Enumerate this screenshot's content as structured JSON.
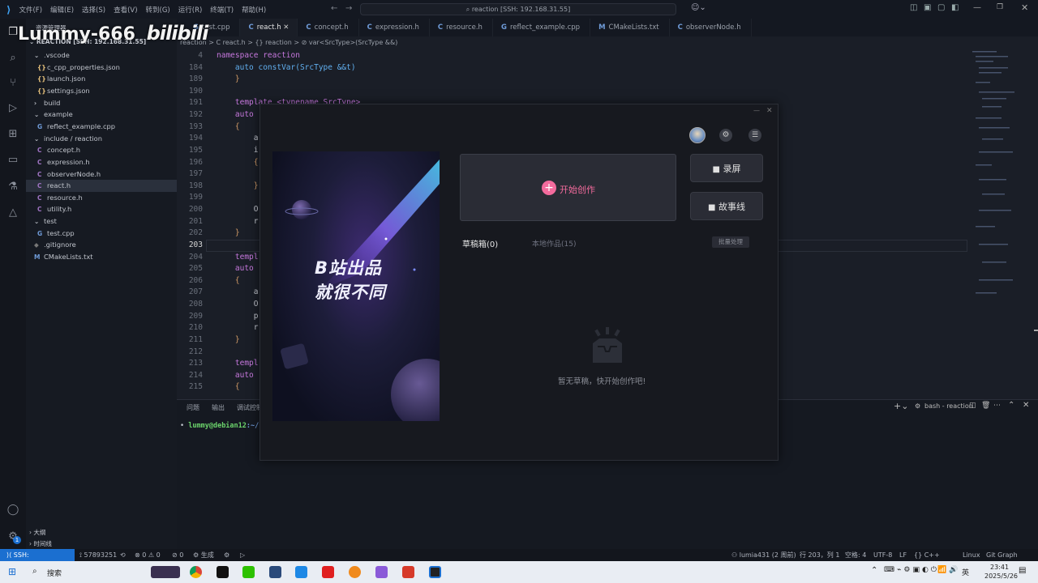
{
  "titlebar": {
    "menu": [
      "文件(F)",
      "编辑(E)",
      "选择(S)",
      "查看(V)",
      "转到(G)",
      "运行(R)",
      "终端(T)",
      "帮助(H)"
    ],
    "search": "reaction [SSH: 192.168.31.55]"
  },
  "watermark": {
    "text": "Lummy-666",
    "logo": "bilibili"
  },
  "sidebar": {
    "header": "资源管理器",
    "root": "REACTION [SSH: 192.168.31.55]",
    "rows": [
      {
        "label": ".vscode",
        "kind": "folder-open",
        "depth": 1
      },
      {
        "label": "c_cpp_properties.json",
        "kind": "json",
        "depth": 2
      },
      {
        "label": "launch.json",
        "kind": "json",
        "depth": 2
      },
      {
        "label": "settings.json",
        "kind": "json",
        "depth": 2
      },
      {
        "label": "build",
        "kind": "folder",
        "depth": 1
      },
      {
        "label": "example",
        "kind": "folder-open",
        "depth": 1
      },
      {
        "label": "reflect_example.cpp",
        "kind": "cpp",
        "depth": 2
      },
      {
        "label": "include / reaction",
        "kind": "folder-open",
        "depth": 1
      },
      {
        "label": "concept.h",
        "kind": "h",
        "depth": 2
      },
      {
        "label": "expression.h",
        "kind": "h",
        "depth": 2
      },
      {
        "label": "observerNode.h",
        "kind": "h",
        "depth": 2
      },
      {
        "label": "react.h",
        "kind": "h",
        "depth": 2,
        "active": true
      },
      {
        "label": "resource.h",
        "kind": "h",
        "depth": 2
      },
      {
        "label": "utility.h",
        "kind": "h",
        "depth": 2
      },
      {
        "label": "test",
        "kind": "folder-open",
        "depth": 1
      },
      {
        "label": "test.cpp",
        "kind": "cpp",
        "depth": 2
      },
      {
        "label": ".gitignore",
        "kind": "git",
        "depth": 1
      },
      {
        "label": "CMakeLists.txt",
        "kind": "cmake",
        "depth": 1
      }
    ],
    "outline": "大纲",
    "timeline": "时间线"
  },
  "tabs": [
    {
      "label": "test.cpp",
      "active": false
    },
    {
      "label": "react.h",
      "active": true
    },
    {
      "label": "concept.h",
      "active": false
    },
    {
      "label": "expression.h",
      "active": false
    },
    {
      "label": "resource.h",
      "active": false
    },
    {
      "label": "reflect_example.cpp",
      "active": false
    },
    {
      "label": "CMakeLists.txt",
      "active": false
    },
    {
      "label": "observerNode.h",
      "active": false
    }
  ],
  "breadcrumb": "reaction  >  C react.h  >  {} reaction  >  ⊘ var<SrcType>(SrcType &&)",
  "editor": {
    "lines": [
      {
        "n": "4",
        "code": "namespace reaction"
      },
      {
        "n": "184",
        "code": "    auto constVar(SrcType &&t)"
      },
      {
        "n": "189",
        "code": "    }"
      },
      {
        "n": "190",
        "code": ""
      },
      {
        "n": "191",
        "code": "    template <typename SrcType>"
      },
      {
        "n": "192",
        "code": "    auto"
      },
      {
        "n": "193",
        "code": "    {"
      },
      {
        "n": "194",
        "code": "        a"
      },
      {
        "n": "195",
        "code": "        i"
      },
      {
        "n": "196",
        "code": "        {"
      },
      {
        "n": "197",
        "code": ""
      },
      {
        "n": "198",
        "code": "        }"
      },
      {
        "n": "199",
        "code": ""
      },
      {
        "n": "200",
        "code": "        O"
      },
      {
        "n": "201",
        "code": "        r"
      },
      {
        "n": "202",
        "code": "    }"
      },
      {
        "n": "203",
        "code": "",
        "current": true
      },
      {
        "n": "204",
        "code": "    templ"
      },
      {
        "n": "205",
        "code": "    auto"
      },
      {
        "n": "206",
        "code": "    {"
      },
      {
        "n": "207",
        "code": "        a"
      },
      {
        "n": "208",
        "code": "        O"
      },
      {
        "n": "209",
        "code": "        p"
      },
      {
        "n": "210",
        "code": "        r"
      },
      {
        "n": "211",
        "code": "    }"
      },
      {
        "n": "212",
        "code": ""
      },
      {
        "n": "213",
        "code": "    templ"
      },
      {
        "n": "214",
        "code": "    auto"
      },
      {
        "n": "215",
        "code": "    {"
      }
    ]
  },
  "panel": {
    "tabs": [
      "问题",
      "输出",
      "调试控制"
    ],
    "terminal_name": "bash - reaction",
    "prompt_user": "lummy@debian12",
    "prompt_path": ":~/re"
  },
  "overlay": {
    "banner_line1": "B站出品",
    "banner_line2": "就很不同",
    "start_label": "开始创作",
    "record_label": "录屏",
    "story_label": "故事线",
    "tab_drafts": "草稿箱(0)",
    "tab_local": "本地作品(15)",
    "batch_label": "批量处理",
    "empty_text": "暂无草稿，快开始创作吧!",
    "accent": "#f36b9d"
  },
  "status": {
    "remote": "SSH: 192.168.31.55",
    "items_left": [
      "⟟ 57893251",
      "⟲",
      "⊗ 0 ⚠ 0",
      "⊘ 0",
      "⚙ 生成",
      "⚙",
      "▷"
    ],
    "items_right": [
      "lumia431 (2 周前)",
      "行 203，列 1",
      "空格: 4",
      "UTF-8",
      "LF",
      "{} C++",
      "Linux",
      "Git Graph"
    ]
  },
  "taskbar": {
    "search": "搜索",
    "lang": "英",
    "time": "23:41",
    "date": "2025/5/26",
    "badge": "1"
  }
}
